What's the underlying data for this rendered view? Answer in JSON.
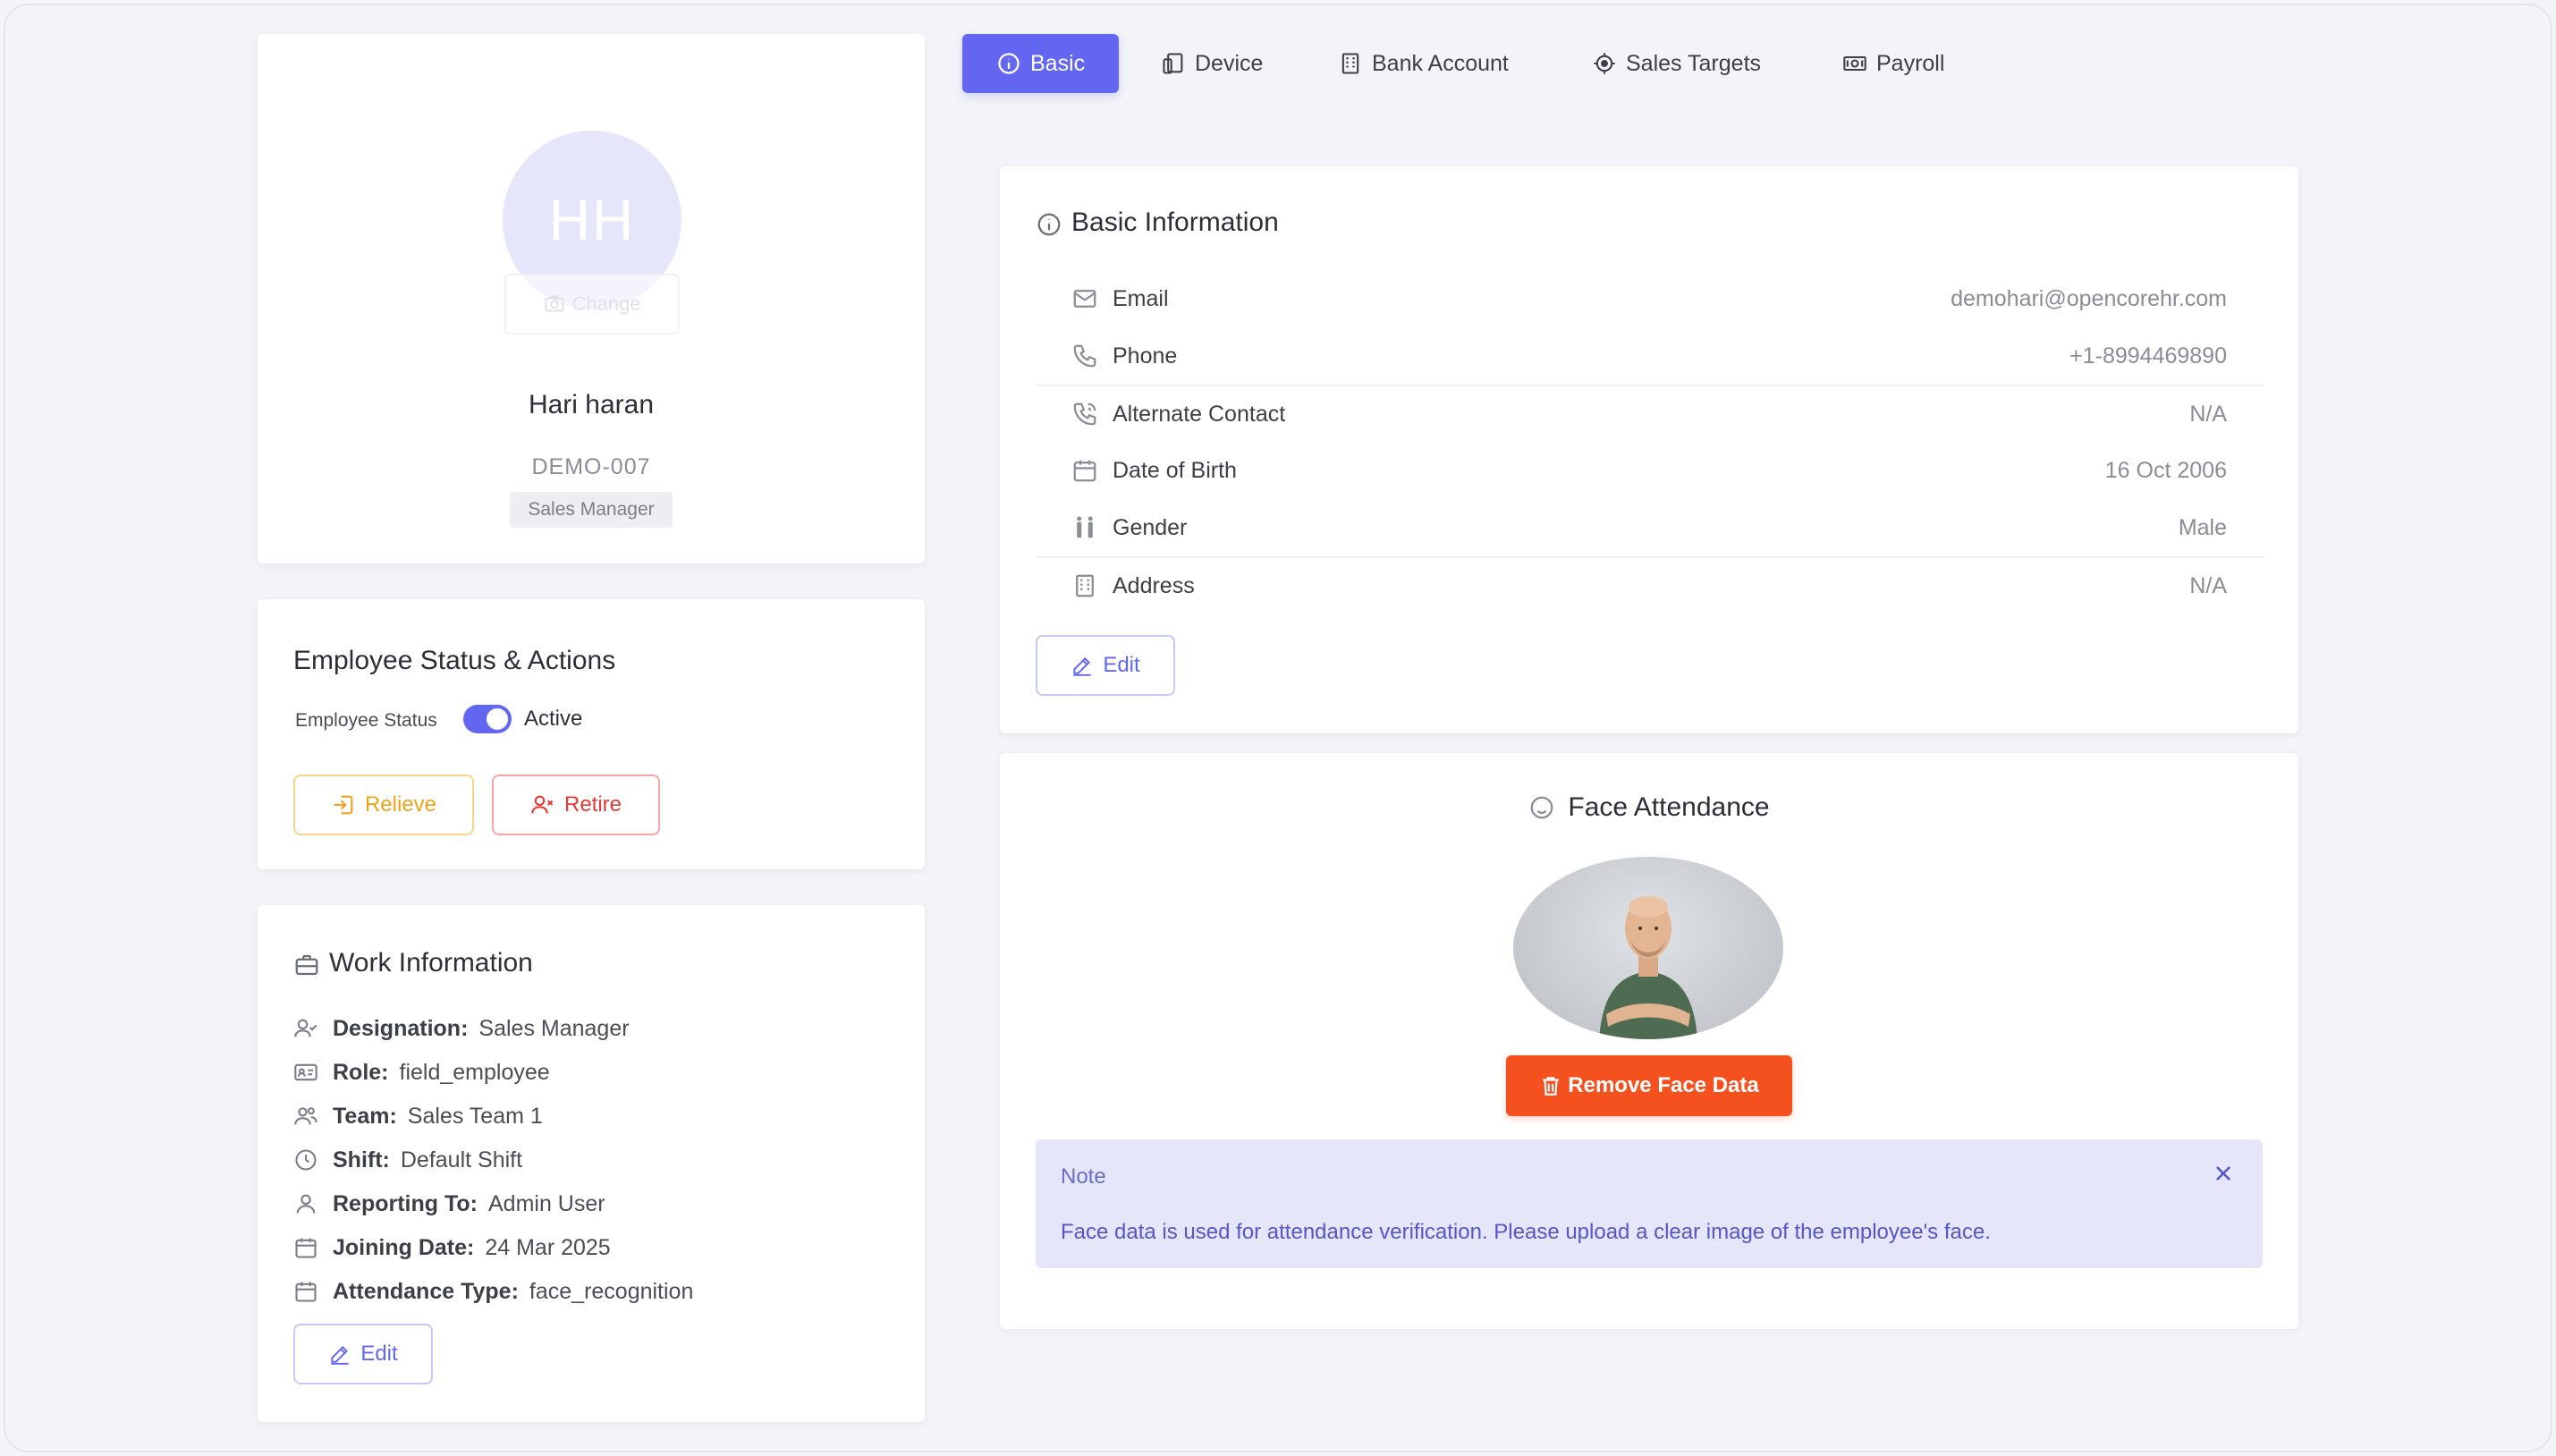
{
  "profile": {
    "initials": "HH",
    "change_label": "Change",
    "name": "Hari haran",
    "employee_id": "DEMO-007",
    "designation_badge": "Sales Manager"
  },
  "status_card": {
    "title": "Employee Status & Actions",
    "status_label": "Employee Status",
    "status_value": "Active",
    "toggle_on": true,
    "relieve_label": "Relieve",
    "retire_label": "Retire"
  },
  "work_info": {
    "title": "Work Information",
    "rows": [
      {
        "icon": "user-check-icon",
        "key": "Designation:",
        "value": "Sales Manager"
      },
      {
        "icon": "id-card-icon",
        "key": "Role:",
        "value": "field_employee"
      },
      {
        "icon": "users-icon",
        "key": "Team:",
        "value": "Sales Team 1"
      },
      {
        "icon": "clock-icon",
        "key": "Shift:",
        "value": "Default Shift"
      },
      {
        "icon": "user-icon",
        "key": "Reporting To:",
        "value": "Admin User"
      },
      {
        "icon": "calendar-icon",
        "key": "Joining Date:",
        "value": "24 Mar 2025"
      },
      {
        "icon": "calendar-icon",
        "key": "Attendance Type:",
        "value": "face_recognition"
      }
    ],
    "edit_label": "Edit"
  },
  "tabs": [
    {
      "label": "Basic",
      "icon": "info-icon",
      "active": true
    },
    {
      "label": "Device",
      "icon": "device-icon",
      "active": false
    },
    {
      "label": "Bank Account",
      "icon": "bank-icon",
      "active": false
    },
    {
      "label": "Sales Targets",
      "icon": "target-icon",
      "active": false
    },
    {
      "label": "Payroll",
      "icon": "payroll-icon",
      "active": false
    }
  ],
  "basic_info": {
    "title": "Basic Information",
    "rows": [
      {
        "icon": "mail-icon",
        "label": "Email",
        "value": "demohari@opencorehr.com"
      },
      {
        "icon": "phone-icon",
        "label": "Phone",
        "value": "+1-8994469890"
      },
      {
        "icon": "phone-call-icon",
        "label": "Alternate Contact",
        "value": "N/A"
      },
      {
        "icon": "calendar-icon",
        "label": "Date of Birth",
        "value": "16 Oct 2006"
      },
      {
        "icon": "gender-icon",
        "label": "Gender",
        "value": "Male"
      },
      {
        "icon": "building-icon",
        "label": "Address",
        "value": "N/A"
      }
    ],
    "edit_label": "Edit"
  },
  "face_attendance": {
    "title": "Face Attendance",
    "remove_label": "Remove Face Data",
    "note_title": "Note",
    "note_text": "Face data is used for attendance verification. Please upload a clear image of the employee's face."
  },
  "colors": {
    "accent": "#6366f1",
    "warning": "#f0a21b",
    "danger": "#e53935",
    "remove": "#f4511e",
    "note_bg": "#e6e6fb"
  }
}
